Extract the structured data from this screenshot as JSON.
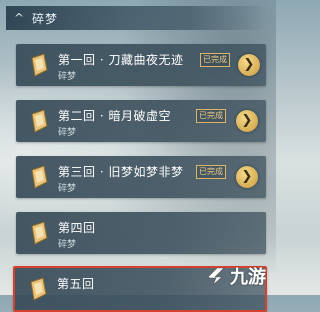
{
  "header": {
    "caret": "^",
    "title": "碎梦"
  },
  "chapters": [
    {
      "title": "第一回 · 刀藏曲夜无迹",
      "sub": "碎梦",
      "badge": "已完成",
      "arrow": "❯"
    },
    {
      "title": "第二回 · 暗月破虚空",
      "sub": "碎梦",
      "badge": "已完成",
      "arrow": "❯"
    },
    {
      "title": "第三回 · 旧梦如梦非梦",
      "sub": "碎梦",
      "badge": "已完成",
      "arrow": "❯"
    },
    {
      "title": "第四回",
      "sub": "碎梦",
      "badge": "",
      "arrow": ""
    },
    {
      "title": "第五回",
      "sub": "",
      "badge": "",
      "arrow": ""
    }
  ],
  "watermark": {
    "text": "九游"
  }
}
